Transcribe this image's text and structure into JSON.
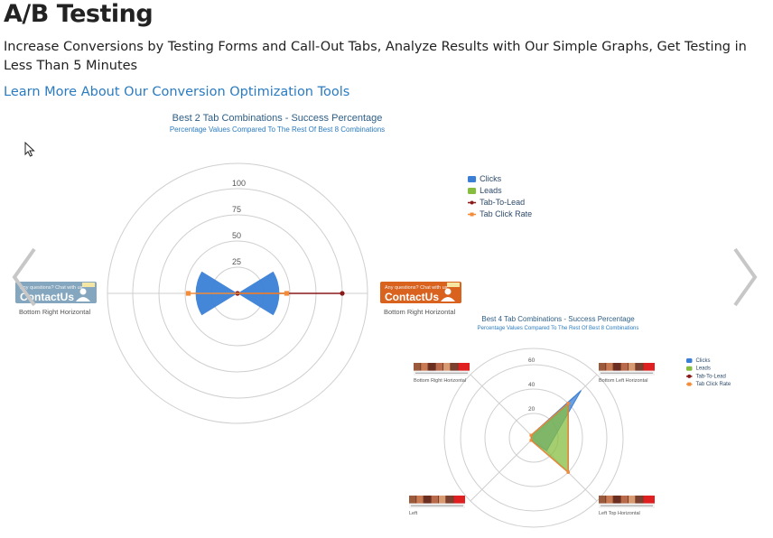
{
  "header": {
    "title": "A/B Testing",
    "subtitle": "Increase Conversions by Testing Forms and Call-Out Tabs, Analyze Results with Our Simple Graphs, Get Testing in Less Than 5 Minutes",
    "link_label": "Learn More About Our Conversion Optimization Tools"
  },
  "carousel": {
    "prev_icon": "chevron-left-icon",
    "next_icon": "chevron-right-icon"
  },
  "colors": {
    "clicks": "#3a7fd5",
    "leads": "#86bd3f",
    "tab_to_lead": "#8b1a1a",
    "tab_click_rate": "#f28c38",
    "grid": "#cfcfcf",
    "title": "#2e5e86",
    "link": "#2a7bc0"
  },
  "chart_data": [
    {
      "type": "radar",
      "title": "Best 2 Tab Combinations - Success Percentage",
      "subtitle": "Percentage Values Compared To The Rest Of Best 8 Combinations",
      "categories": [
        "Bottom Right Horizontal",
        "Bottom Right Horizontal"
      ],
      "tab_images": [
        {
          "top_text": "Any questions? Chat with us",
          "main_text": "ContactUs",
          "style": "faded-blue"
        },
        {
          "top_text": "Any questions? Chat with us",
          "main_text": "ContactUs",
          "style": "orange"
        }
      ],
      "rlim": [
        0,
        100
      ],
      "rticks": [
        25,
        50,
        75,
        100
      ],
      "legend_position": "right",
      "series": [
        {
          "name": "Clicks",
          "kind": "area",
          "values": [
            40,
            40
          ]
        },
        {
          "name": "Leads",
          "kind": "area",
          "values": [
            0,
            0
          ]
        },
        {
          "name": "Tab-To-Lead",
          "kind": "line",
          "values": [
            0,
            100
          ]
        },
        {
          "name": "Tab Click Rate",
          "kind": "line",
          "values": [
            47,
            47
          ]
        }
      ]
    },
    {
      "type": "radar",
      "title": "Best 4 Tab Combinations - Success Percentage",
      "subtitle": "Percentage Values Compared To The Rest Of Best 8 Combinations",
      "categories": [
        "Bottom Left Horizontal",
        "Left Top Horizontal",
        "Left",
        "Bottom Right Horizontal"
      ],
      "tab_images": [
        {
          "top_text": "",
          "main_text": "",
          "style": "photo-strip"
        },
        {
          "top_text": "",
          "main_text": "",
          "style": "photo-strip"
        },
        {
          "top_text": "",
          "main_text": "",
          "style": "photo-strip"
        },
        {
          "top_text": "",
          "main_text": "",
          "style": "photo-strip"
        }
      ],
      "rlim": [
        0,
        60
      ],
      "rticks": [
        20,
        40,
        60
      ],
      "legend_position": "right",
      "series": [
        {
          "name": "Clicks",
          "kind": "area",
          "values": [
            55,
            15,
            3,
            3
          ]
        },
        {
          "name": "Leads",
          "kind": "area",
          "values": [
            40,
            40,
            3,
            3
          ]
        },
        {
          "name": "Tab-To-Lead",
          "kind": "line",
          "values": [
            40,
            40,
            3,
            3
          ]
        },
        {
          "name": "Tab Click Rate",
          "kind": "line",
          "values": [
            40,
            40,
            3,
            3
          ]
        }
      ]
    }
  ]
}
